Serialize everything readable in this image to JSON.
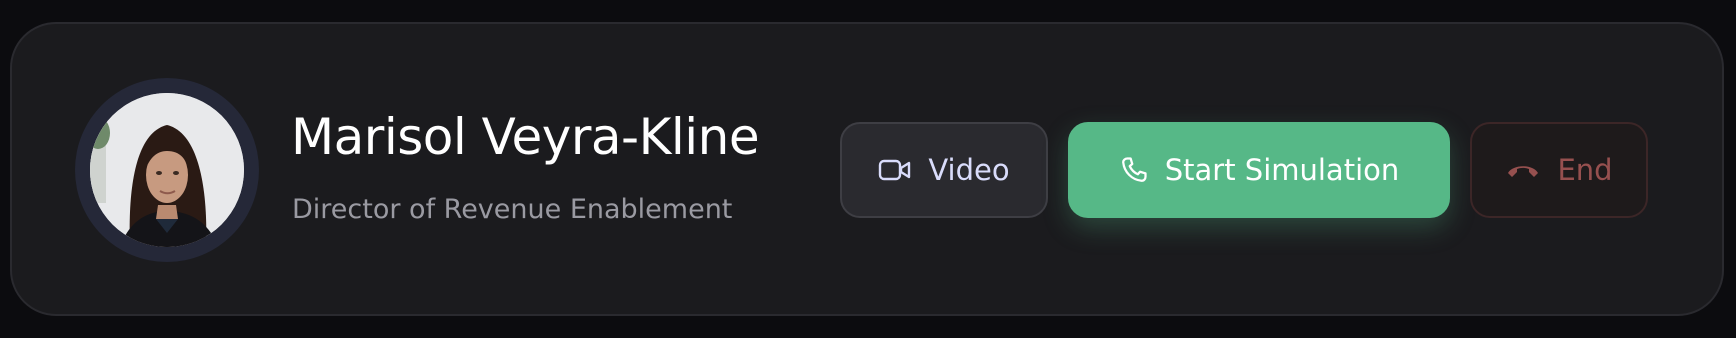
{
  "contact": {
    "name": "Marisol Veyra-Kline",
    "role": "Director of Revenue Enablement"
  },
  "actions": {
    "video_label": "Video",
    "start_label": "Start Simulation",
    "end_label": "End"
  },
  "icons": {
    "video": "video-camera-icon",
    "start": "phone-icon",
    "end": "phone-hangup-icon"
  },
  "colors": {
    "card_background": "#1b1b1e",
    "start_accent": "#56b887",
    "video_text": "#d9dcfb",
    "end_text": "#96504f",
    "avatar_ring": "#252838"
  }
}
